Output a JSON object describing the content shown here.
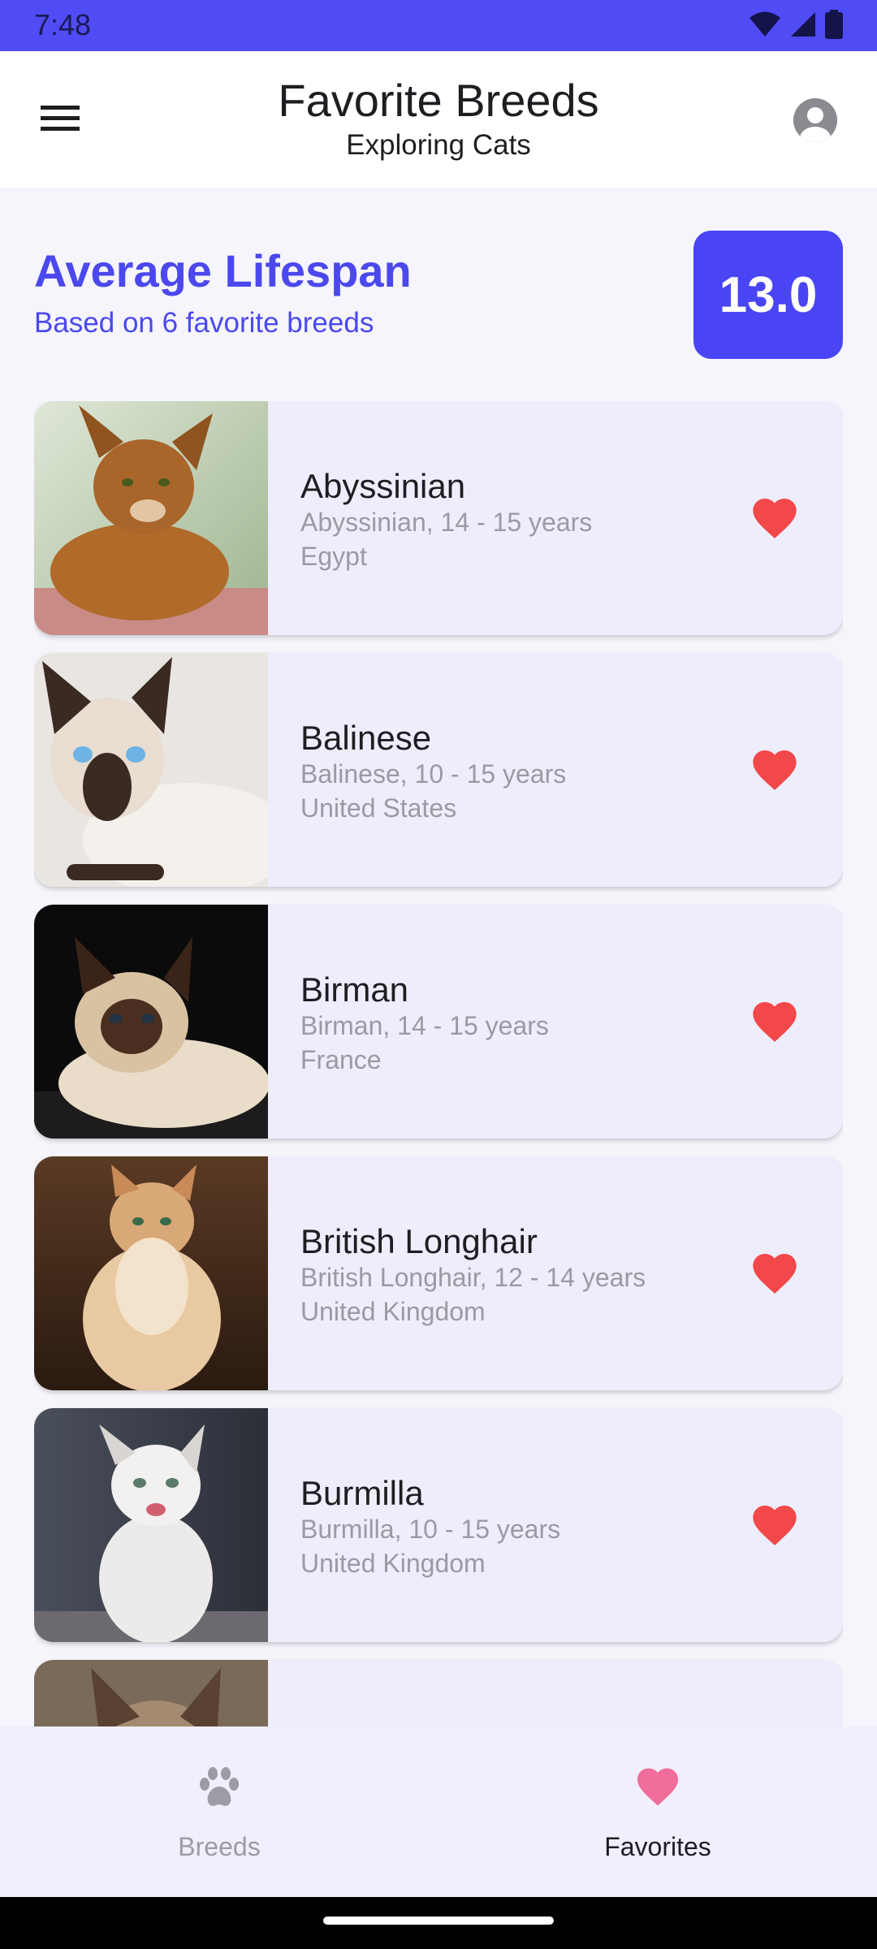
{
  "status_bar": {
    "time": "7:48",
    "icons": [
      "wifi-icon",
      "signal-icon",
      "battery-icon"
    ]
  },
  "app_bar": {
    "title": "Favorite Breeds",
    "subtitle": "Exploring Cats",
    "menu_icon": "menu-icon",
    "account_icon": "account-icon"
  },
  "summary": {
    "title": "Average Lifespan",
    "subtitle": "Based on 6 favorite breeds",
    "value": "13.0"
  },
  "breeds": [
    {
      "name": "Abyssinian",
      "detail": "Abyssinian, 14 - 15 years",
      "origin": "Egypt",
      "favorite": true
    },
    {
      "name": "Balinese",
      "detail": "Balinese, 10 - 15 years",
      "origin": "United States",
      "favorite": true
    },
    {
      "name": "Birman",
      "detail": "Birman, 14 - 15 years",
      "origin": "France",
      "favorite": true
    },
    {
      "name": "British Longhair",
      "detail": "British Longhair, 12 - 14 years",
      "origin": "United Kingdom",
      "favorite": true
    },
    {
      "name": "Burmilla",
      "detail": "Burmilla, 10 - 15 years",
      "origin": "United Kingdom",
      "favorite": true
    },
    {
      "name": "",
      "detail": "",
      "origin": "",
      "favorite": true
    }
  ],
  "bottom_nav": {
    "items": [
      {
        "label": "Breeds",
        "icon": "paw-icon",
        "selected": false
      },
      {
        "label": "Favorites",
        "icon": "heart-icon",
        "selected": true
      }
    ]
  },
  "colors": {
    "primary": "#4f4cf5",
    "accent_text": "#4b48ee",
    "favorite_heart": "#f2484a",
    "nav_heart": "#f06e9b",
    "card_bg": "#eeedfb"
  }
}
